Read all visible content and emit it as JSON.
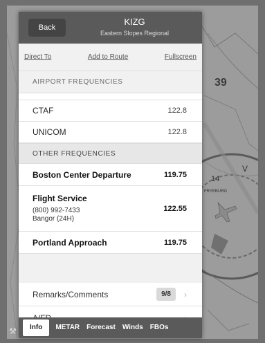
{
  "header": {
    "back_label": "Back",
    "title": "KIZG",
    "subtitle": "Eastern Slopes Regional"
  },
  "actions": {
    "direct_to": "Direct To",
    "add_to_route": "Add to Route",
    "fullscreen": "Fullscreen"
  },
  "airport_frequencies": {
    "header": "AIRPORT FREQUENCIES",
    "items": [
      {
        "name": "CTAF",
        "value": "122.8"
      },
      {
        "name": "UNICOM",
        "value": "122.8"
      }
    ]
  },
  "other_frequencies": {
    "header": "OTHER FREQUENCIES",
    "items": [
      {
        "name": "Boston Center Departure",
        "value": "119.75"
      },
      {
        "name": "Flight Service",
        "phone": "(800) 992-7433",
        "note": "Bangor (24H)",
        "value": "122.55"
      },
      {
        "name": "Portland Approach",
        "value": "119.75"
      }
    ]
  },
  "remarks": {
    "label": "Remarks/Comments",
    "badge": "9/8"
  },
  "afd": {
    "label": "A/FD"
  },
  "map_text": {
    "elev": "39",
    "v": "V",
    "n14": "14",
    "town": "FRYEBURG"
  },
  "tabs": [
    "Info",
    "METAR",
    "Forecast",
    "Winds",
    "FBOs"
  ],
  "colors": {
    "header_bg": "#5a5a5a",
    "map_bg": "#9c9c9c"
  }
}
